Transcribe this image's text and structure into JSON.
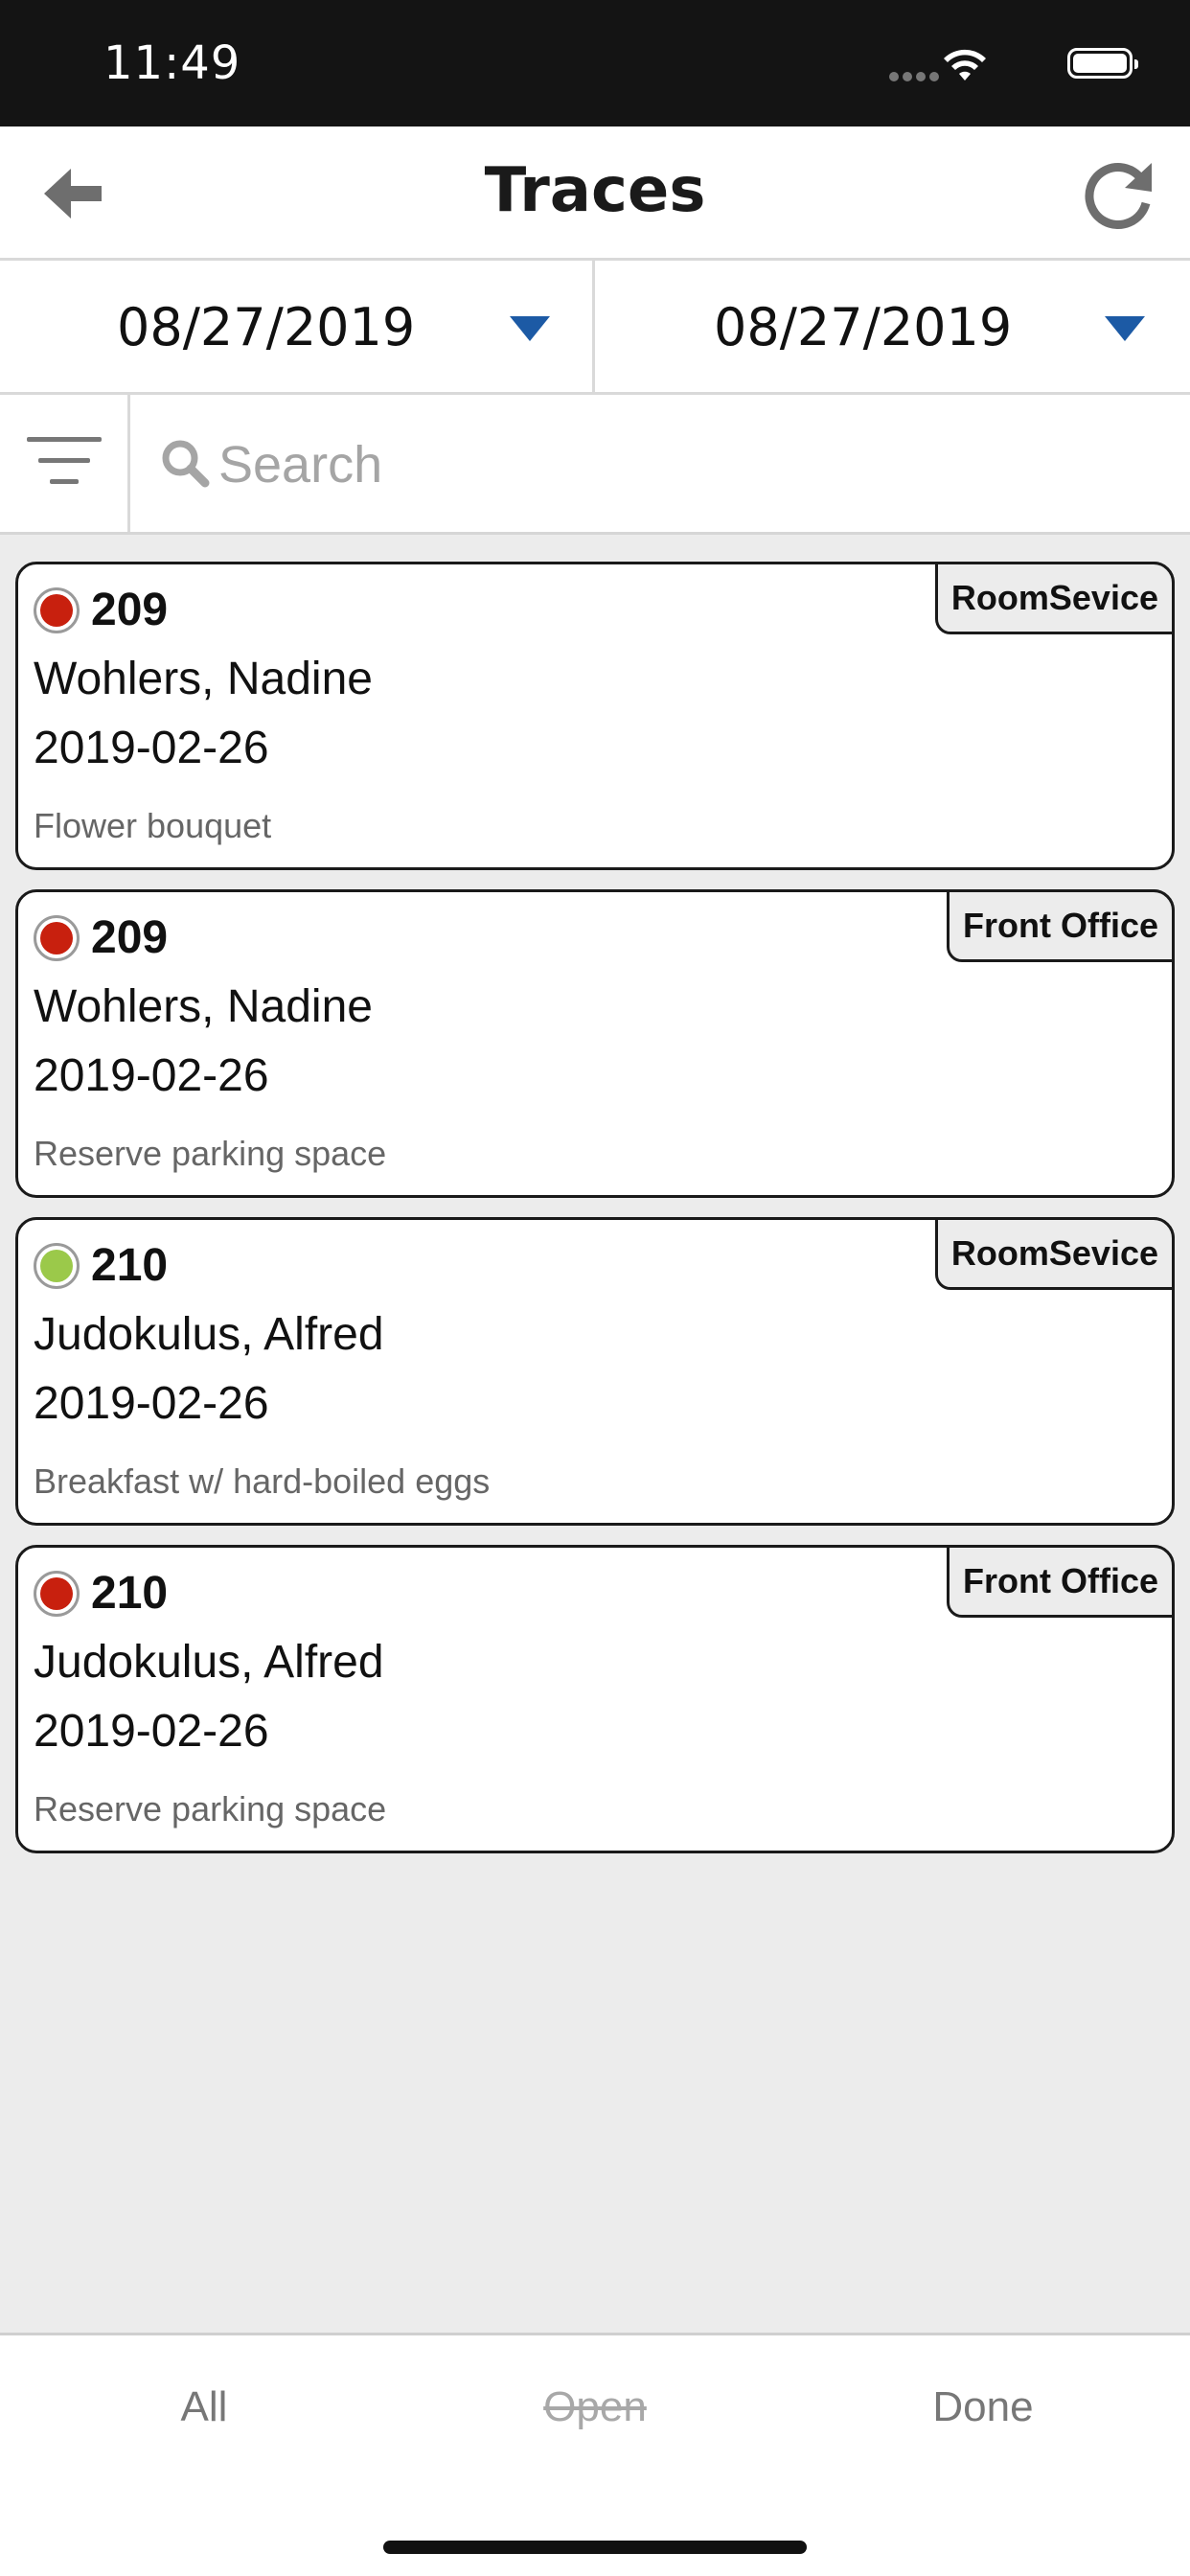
{
  "status_bar": {
    "time": "11:49"
  },
  "header": {
    "title": "Traces",
    "back_icon": "arrow-left-icon",
    "refresh_icon": "refresh-icon"
  },
  "date_range": {
    "from": "08/27/2019",
    "to": "08/27/2019"
  },
  "search": {
    "placeholder": "Search",
    "value": ""
  },
  "traces": [
    {
      "status_color": "#c8200e",
      "room": "209",
      "guest": "Wohlers, Nadine",
      "date": "2019-02-26",
      "note": "Flower bouquet",
      "department": "RoomSevice"
    },
    {
      "status_color": "#c8200e",
      "room": "209",
      "guest": "Wohlers, Nadine",
      "date": "2019-02-26",
      "note": "Reserve parking space",
      "department": "Front Office"
    },
    {
      "status_color": "#9bc94a",
      "room": "210",
      "guest": "Judokulus, Alfred",
      "date": "2019-02-26",
      "note": "Breakfast w/ hard-boiled eggs",
      "department": "RoomSevice"
    },
    {
      "status_color": "#c8200e",
      "room": "210",
      "guest": "Judokulus, Alfred",
      "date": "2019-02-26",
      "note": "Reserve parking space",
      "department": "Front Office"
    }
  ],
  "tabs": {
    "all": "All",
    "open": "Open",
    "done": "Done"
  },
  "colors": {
    "accent": "#1c5aa5",
    "open_status": "#c8200e",
    "done_status": "#9bc94a"
  }
}
